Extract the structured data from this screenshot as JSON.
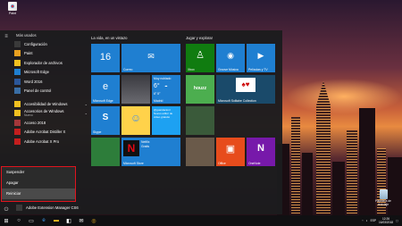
{
  "desktop": {
    "paint_icon_label": "Paint",
    "recycle_bin_label": "Papelera de reciclaje"
  },
  "start_menu": {
    "section_recent": "Más usados",
    "apps": [
      {
        "label": "Configuración",
        "icon": "gear-icon",
        "color": "#3a3a3a"
      },
      {
        "label": "Paint",
        "icon": "paint-icon",
        "color": "#e8a020"
      },
      {
        "label": "Explorador de archivos",
        "icon": "folder-icon",
        "color": "#f0c020"
      },
      {
        "label": "Microsoft Edge",
        "icon": "edge-icon",
        "color": "#1f7fd1"
      },
      {
        "label": "Word 2016",
        "icon": "word-icon",
        "color": "#2b579a"
      },
      {
        "label": "Panel de control",
        "icon": "control-panel-icon",
        "color": "#3a6ea5"
      }
    ],
    "folders": [
      {
        "label": "Accesibilidad de Windows",
        "sub": "",
        "icon": "folder-icon",
        "color": "#f0c020"
      },
      {
        "label": "Accesorios de Windows",
        "sub": "Nuevo",
        "icon": "folder-icon",
        "color": "#f0c020"
      },
      {
        "label": "Acceso 2018",
        "sub": "",
        "icon": "access-icon",
        "color": "#a4373a"
      },
      {
        "label": "Adobe Acrobat Distiller X",
        "sub": "",
        "icon": "acrobat-icon",
        "color": "#c41e1e"
      },
      {
        "label": "Adobe Acrobat X Pro",
        "sub": "",
        "icon": "acrobat-icon",
        "color": "#c41e1e"
      }
    ],
    "bottom_app": {
      "label": "Adobe Extension Manager CS6",
      "icon": "adobe-icon",
      "color": "#3a3a3a"
    },
    "group_life": "La vida, en un vistazo",
    "group_play": "Jugar y explorar",
    "tiles": {
      "calendar_day": "16",
      "mail": "Correo",
      "edge": "Microsoft Edge",
      "weather_title": "Muy nublado",
      "weather_temp": "6°",
      "weather_range": "6° 5°",
      "weather_city": "Madrid",
      "skype": "Skype",
      "twitter_handle": "@guardacionl",
      "twitter_text": "Nuevo editor de vídeo gratuito",
      "netflix_title": "Netflix",
      "netflix_sub": "Gratis",
      "store": "Microsoft Store",
      "xbox": "Xbox",
      "groove": "Groove Música",
      "movies": "Películas y TV",
      "houzz": "houzz",
      "solitaire": "Microsoft Solitaire Collection",
      "office": "Office",
      "onenote": "OneNote"
    }
  },
  "power_menu": {
    "items": [
      "Suspender",
      "Apagar",
      "Reiniciar"
    ],
    "selected_index": 2,
    "highlight_color": "#e0141e"
  },
  "taskbar": {
    "time": "12:26",
    "date": "16/03/2018",
    "language": "ESP"
  }
}
